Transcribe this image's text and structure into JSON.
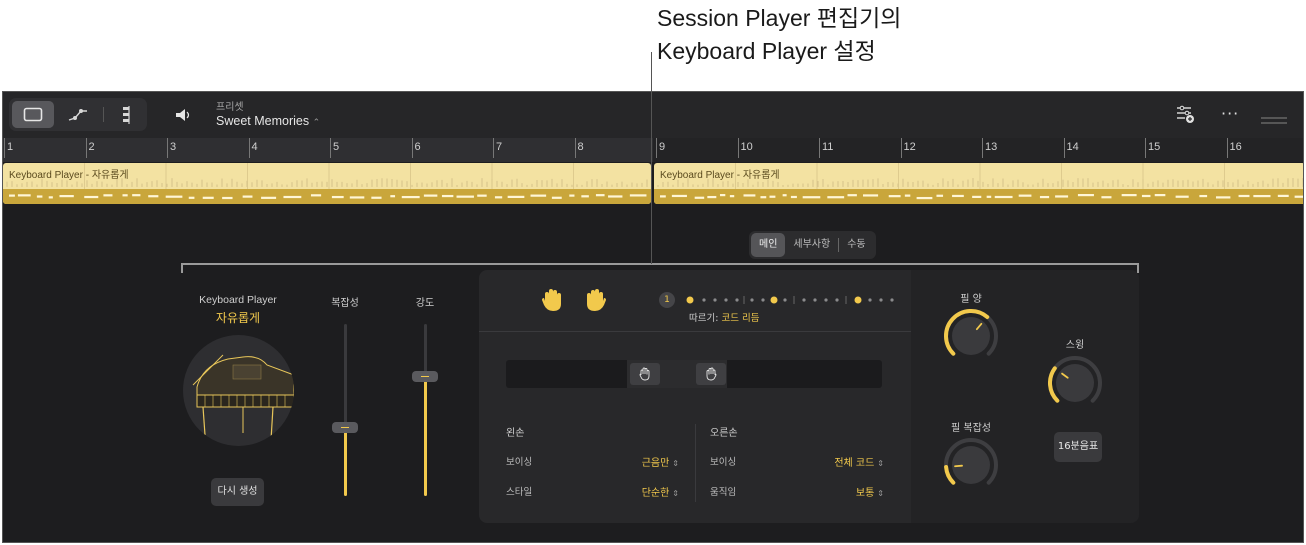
{
  "callout": {
    "line1": "Session Player 편집기의",
    "line2": "Keyboard Player 설정"
  },
  "toolbar": {
    "preset_label": "프리셋",
    "preset_name": "Sweet Memories",
    "icons": [
      "region-view-icon",
      "automation-icon",
      "score-icon",
      "speaker-icon",
      "filter-settings-icon",
      "more-icon",
      "grip-icon"
    ]
  },
  "ruler": {
    "bars": [
      "1",
      "2",
      "3",
      "4",
      "5",
      "6",
      "7",
      "8",
      "9",
      "10",
      "11",
      "12",
      "13",
      "14",
      "15",
      "16"
    ]
  },
  "regions": [
    {
      "title": "Keyboard Player - 자유롭게"
    },
    {
      "title": "Keyboard Player - 자유롭게"
    }
  ],
  "tabs": [
    {
      "label": "메인",
      "active": true
    },
    {
      "label": "세부사항",
      "active": false
    },
    {
      "label": "수동",
      "active": false
    }
  ],
  "player": {
    "title": "Keyboard Player",
    "style": "자유롭게",
    "regenerate_label": "다시 생성"
  },
  "sliders": {
    "complexity": {
      "label": "복잡성",
      "level": 0.4
    },
    "intensity": {
      "label": "강도",
      "level": 0.7
    }
  },
  "pattern": {
    "step": "1",
    "follow_label": "따르기:",
    "follow_value": "코드 리듬"
  },
  "left_hand": {
    "heading": "왼손",
    "voicing_label": "보이싱",
    "voicing_value": "근음만",
    "style_label": "스타일",
    "style_value": "단순한"
  },
  "right_hand": {
    "heading": "오른손",
    "voicing_label": "보이싱",
    "voicing_value": "전체 코드",
    "movement_label": "움직임",
    "movement_value": "보통"
  },
  "knobs": {
    "fill_amount": {
      "label": "필 양",
      "level": 0.65
    },
    "swing": {
      "label": "스윙",
      "level": 0.3
    },
    "fill_complexity": {
      "label": "필 복잡성",
      "level": 0.15
    }
  },
  "swing_button": "16분음표",
  "colors": {
    "accent": "#f2c94c",
    "region": "#f3e2a2",
    "background": "#1d1d1f"
  }
}
